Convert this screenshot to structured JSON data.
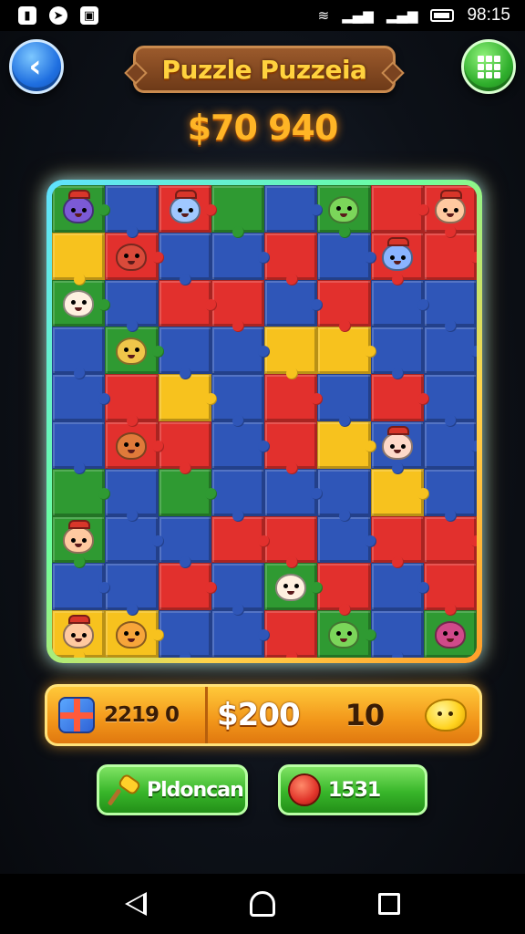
{
  "status_bar": {
    "time": "98:15",
    "left_icons": [
      "phone-lock-icon",
      "messenger-icon",
      "cast-icon"
    ],
    "right_icons": [
      "wifi-icon",
      "signal-icon",
      "signal-icon",
      "battery-icon"
    ]
  },
  "header": {
    "title": "Puzzle Puzzeia",
    "score": "$70 940",
    "back_icon": "back-arrow-icon",
    "menu_icon": "grid-menu-icon"
  },
  "board": {
    "columns": 8,
    "rows": 10,
    "colors": {
      "R": "#e2302d",
      "B": "#2f56b8",
      "G": "#2f9a32",
      "Y": "#f7c21e",
      "O": "#ef6a1f",
      "P": "#6b3cae",
      "D": "#22408a"
    },
    "grid": [
      "GBRGBGRR",
      "YRBBRBRR",
      "GBRRBRBB",
      "BGBBYYBB",
      "BRYBRBRB",
      "BRRBRYBB",
      "GBGBBBYB",
      "GBBRRBRR",
      "BBRBGRBR",
      "YYBBRGBG"
    ],
    "critters": [
      {
        "row": 0,
        "col": 0,
        "color": "#7b5ad6",
        "hat": true
      },
      {
        "row": 0,
        "col": 2,
        "color": "#a0c8ff",
        "hat": true
      },
      {
        "row": 0,
        "col": 5,
        "color": "#7bd65a",
        "hat": false
      },
      {
        "row": 0,
        "col": 7,
        "color": "#ffc9a0",
        "hat": true
      },
      {
        "row": 1,
        "col": 1,
        "color": "#d94a3a",
        "hat": false
      },
      {
        "row": 1,
        "col": 6,
        "color": "#8ab4ff",
        "hat": true
      },
      {
        "row": 2,
        "col": 0,
        "color": "#fff0e0",
        "hat": false
      },
      {
        "row": 3,
        "col": 1,
        "color": "#f0c64a",
        "hat": false
      },
      {
        "row": 5,
        "col": 1,
        "color": "#e07a3a",
        "hat": false
      },
      {
        "row": 5,
        "col": 6,
        "color": "#ffd9c9",
        "hat": true
      },
      {
        "row": 7,
        "col": 0,
        "color": "#ffc9a0",
        "hat": true
      },
      {
        "row": 8,
        "col": 4,
        "color": "#fff0e0",
        "hat": false
      },
      {
        "row": 9,
        "col": 0,
        "color": "#ffc9a0",
        "hat": true
      },
      {
        "row": 9,
        "col": 1,
        "color": "#f7a53a",
        "hat": false
      },
      {
        "row": 9,
        "col": 5,
        "color": "#7bd65a",
        "hat": false
      },
      {
        "row": 9,
        "col": 7,
        "color": "#d04a8a",
        "hat": false
      }
    ]
  },
  "stats": {
    "gift_value": "2219 0",
    "money": "$200",
    "count": "10",
    "gift_icon": "gift-box-icon",
    "blob_icon": "yellow-blob-icon"
  },
  "buttons": {
    "left_label": "Pldoncan",
    "right_label": "1531",
    "left_icon": "hammer-icon",
    "right_icon": "bomb-icon"
  },
  "nav": {
    "icons": [
      "nav-back-icon",
      "nav-home-icon",
      "nav-recents-icon"
    ]
  }
}
